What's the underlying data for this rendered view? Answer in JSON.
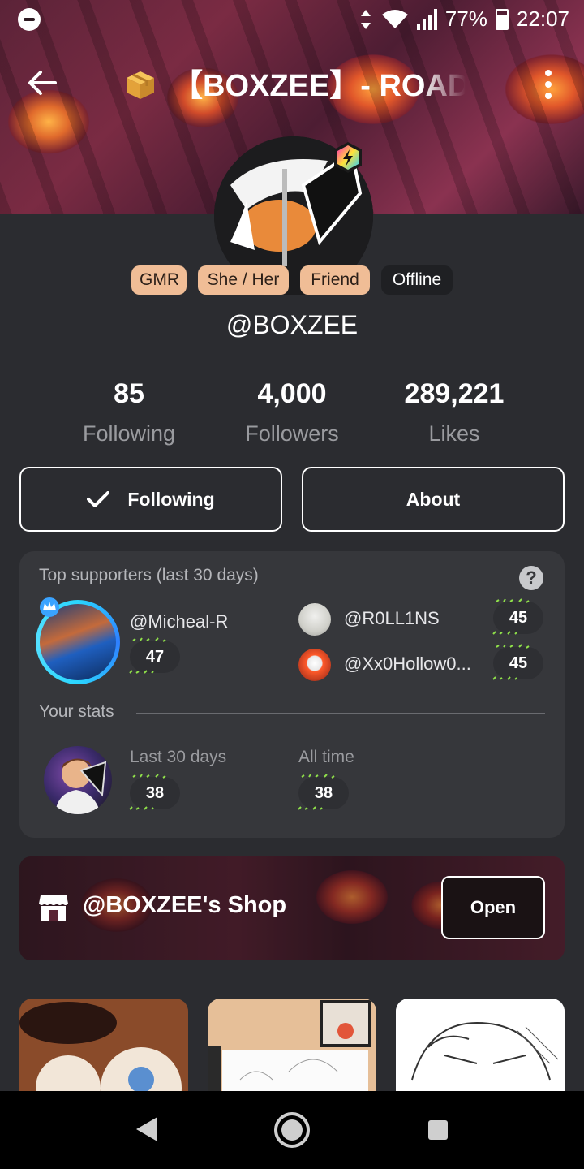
{
  "status_bar": {
    "battery": "77%",
    "time": "22:07"
  },
  "header": {
    "title": "【BOXZEE】- ROAD"
  },
  "profile": {
    "chips": [
      "GMR",
      "She / Her",
      "Friend",
      "Offline"
    ],
    "handle": "@BOXZEE",
    "stats": [
      {
        "value": "85",
        "label": "Following"
      },
      {
        "value": "4,000",
        "label": "Followers"
      },
      {
        "value": "289,221",
        "label": "Likes"
      }
    ],
    "buttons": {
      "following": "Following",
      "about": "About"
    }
  },
  "supporters": {
    "title": "Top supporters (last 30 days)",
    "help": "?",
    "top": {
      "name": "@Micheal-R",
      "points": "47"
    },
    "others": [
      {
        "name": "@R0LL1NS",
        "points": "45"
      },
      {
        "name": "@Xx0Hollow0...",
        "points": "45"
      }
    ],
    "your_stats": {
      "title": "Your stats",
      "last30_label": "Last 30 days",
      "last30_value": "38",
      "alltime_label": "All time",
      "alltime_value": "38"
    }
  },
  "shop": {
    "title": "@BOXZEE's Shop",
    "open_label": "Open"
  },
  "colors": {
    "background": "#2b2c30",
    "card": "#36373b",
    "chip_peach": "#f0bd96",
    "muted_text": "#9a9b9f"
  }
}
